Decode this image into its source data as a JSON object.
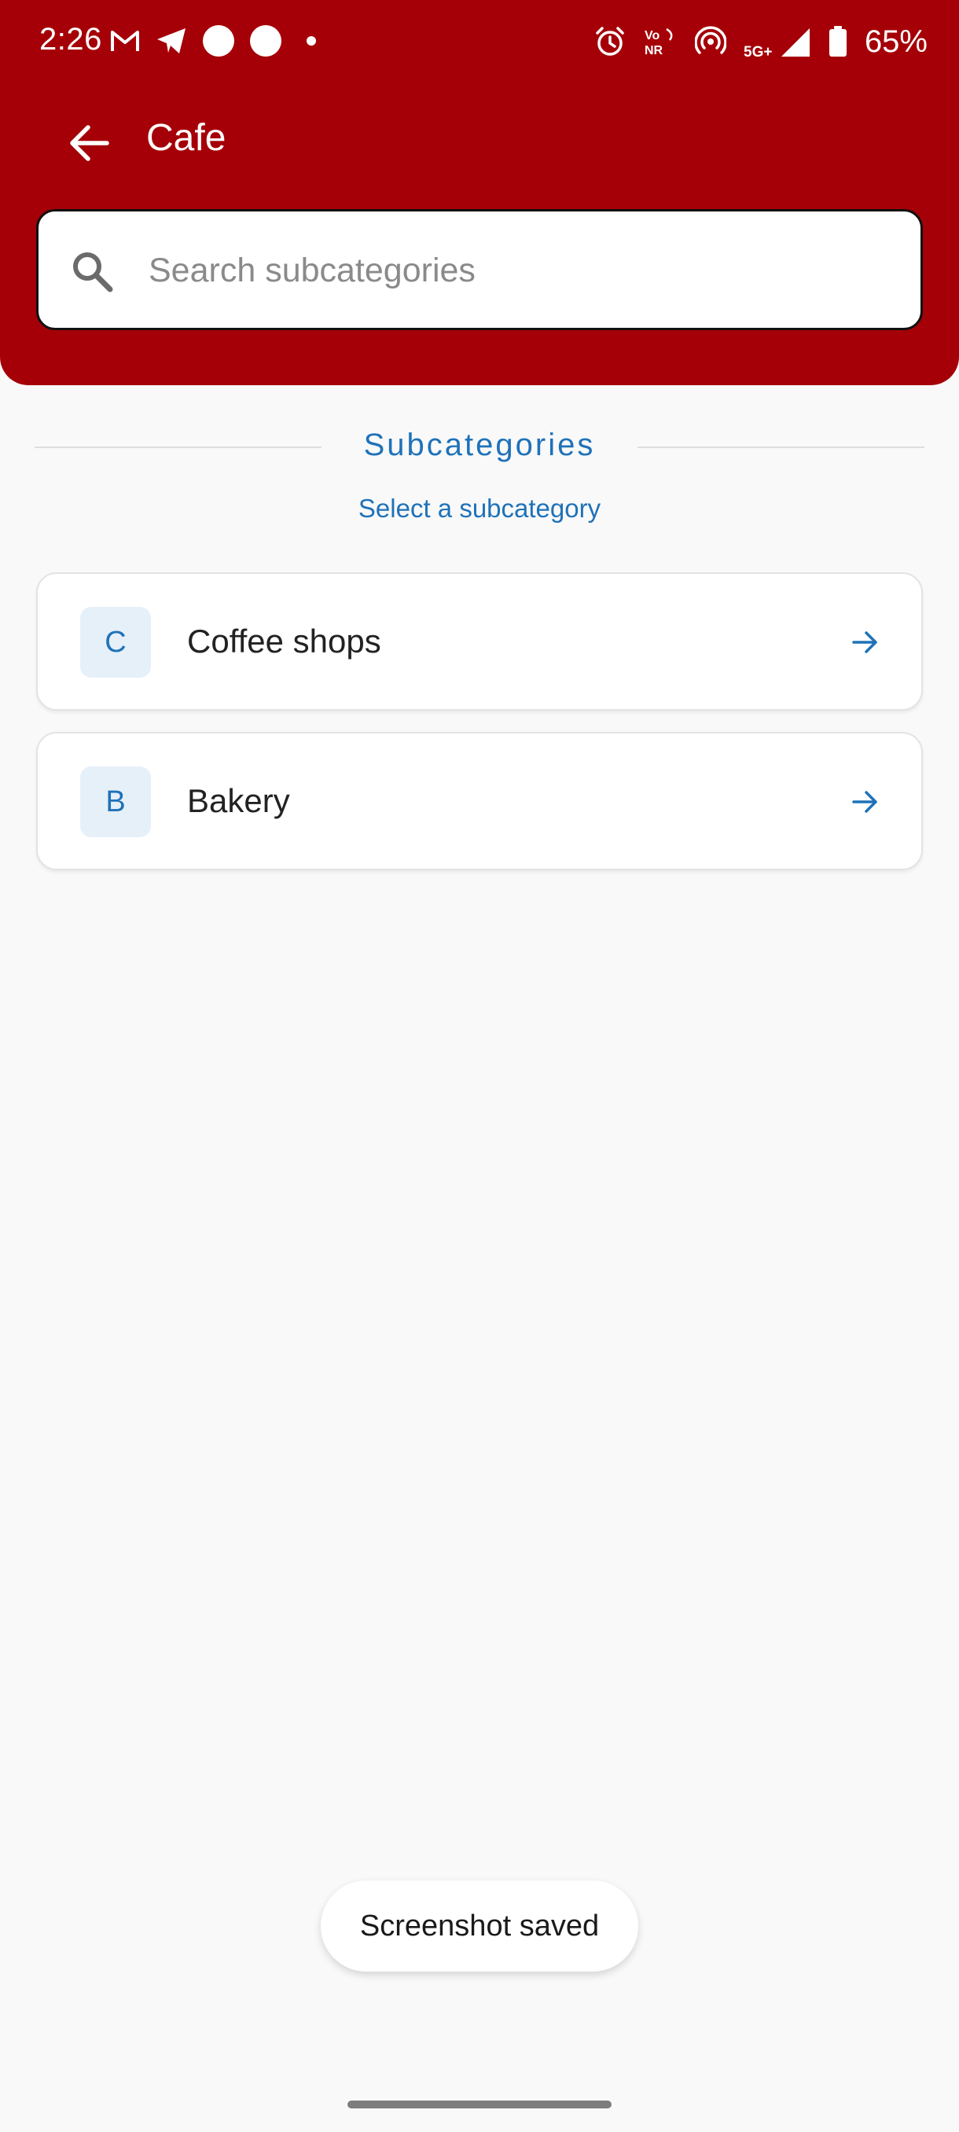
{
  "status_bar": {
    "time": "2:26",
    "battery": "65%",
    "left_icons": [
      "gmail-icon",
      "telegram-icon",
      "circle-icon",
      "circle-icon",
      "dot-icon"
    ],
    "right_icons": [
      "alarm-icon",
      "vonr-icon",
      "hotspot-icon",
      "5g-signal-icon",
      "battery-icon"
    ],
    "vonr_label": "Vo NR",
    "network_label": "5G+"
  },
  "toolbar": {
    "title": "Cafe",
    "back_icon": "arrow-back-icon"
  },
  "search": {
    "placeholder": "Search subcategories",
    "value": "",
    "icon": "search-icon"
  },
  "section": {
    "title": "Subcategories",
    "subtitle": "Select a subcategory"
  },
  "subcategories": [
    {
      "initial": "C",
      "label": "Coffee shops"
    },
    {
      "initial": "B",
      "label": "Bakery"
    }
  ],
  "toast": {
    "message": "Screenshot saved"
  },
  "colors": {
    "header": "#a50007",
    "accent": "#1f72b8",
    "avatar_bg": "#e6f0f9",
    "background": "#f9f9f9"
  }
}
